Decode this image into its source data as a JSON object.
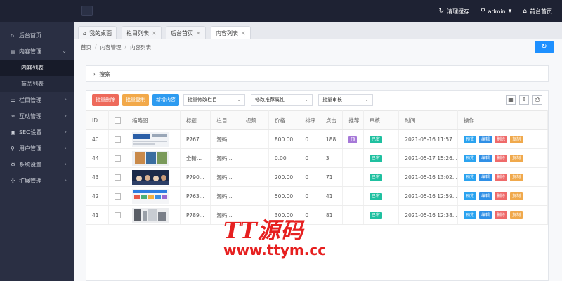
{
  "topbar": {
    "clear_cache": "清理缓存",
    "user": "admin",
    "frontend_home": "前台首页"
  },
  "sidebar": {
    "items": [
      {
        "label": "后台首页",
        "icon": "home-icon"
      },
      {
        "label": "内容管理",
        "icon": "content-icon",
        "expanded": true
      },
      {
        "label": "栏目管理",
        "icon": "column-icon"
      },
      {
        "label": "互动管理",
        "icon": "chat-icon"
      },
      {
        "label": "SEO设置",
        "icon": "seo-icon"
      },
      {
        "label": "用户管理",
        "icon": "user-icon"
      },
      {
        "label": "系统设置",
        "icon": "gear-icon"
      },
      {
        "label": "扩展管理",
        "icon": "extension-icon"
      }
    ],
    "sub_items": [
      "内容列表",
      "商品列表"
    ]
  },
  "tabs": [
    {
      "label": "我的桌面",
      "icon": "desktop-icon"
    },
    {
      "label": "栏目列表"
    },
    {
      "label": "后台首页"
    },
    {
      "label": "内容列表"
    }
  ],
  "breadcrumb": [
    "首页",
    "内容管理",
    "内容列表"
  ],
  "search": {
    "label": "搜索"
  },
  "toolbar": {
    "batch_delete": "批量删除",
    "batch_copy": "批量复制",
    "add_content": "新增内容",
    "batch_column": "批量修改栏目",
    "batch_recommend": "修改推荐属性",
    "batch_audit": "批量审核"
  },
  "table": {
    "headers": [
      "ID",
      "",
      "缩略图",
      "标题",
      "栏目",
      "视频...",
      "价格",
      "排序",
      "点击",
      "推荐",
      "审核",
      "时间",
      "操作"
    ],
    "rows": [
      {
        "id": "40",
        "title": "P767...",
        "column": "源码...",
        "video": "",
        "price": "800.00",
        "sort": "0",
        "clicks": "188",
        "recommend": "頂",
        "audit": "已审",
        "time": "2021-05-16 11:57..."
      },
      {
        "id": "44",
        "title": "全新...",
        "column": "源码...",
        "video": "",
        "price": "0.00",
        "sort": "0",
        "clicks": "3",
        "recommend": "",
        "audit": "已审",
        "time": "2021-05-17 15:26..."
      },
      {
        "id": "43",
        "title": "P790...",
        "column": "源码...",
        "video": "",
        "price": "200.00",
        "sort": "0",
        "clicks": "71",
        "recommend": "",
        "audit": "已审",
        "time": "2021-05-16 13:02..."
      },
      {
        "id": "42",
        "title": "P763...",
        "column": "源码...",
        "video": "",
        "price": "500.00",
        "sort": "0",
        "clicks": "41",
        "recommend": "",
        "audit": "已审",
        "time": "2021-05-16 12:59..."
      },
      {
        "id": "41",
        "title": "P789...",
        "column": "源码...",
        "video": "",
        "price": "300.00",
        "sort": "0",
        "clicks": "81",
        "recommend": "",
        "audit": "已审",
        "time": "2021-05-16 12:38..."
      }
    ],
    "actions": [
      "预览",
      "编辑",
      "删除",
      "复制"
    ]
  },
  "watermark": {
    "title": "TT源码",
    "url": "www.ttym.cc"
  }
}
